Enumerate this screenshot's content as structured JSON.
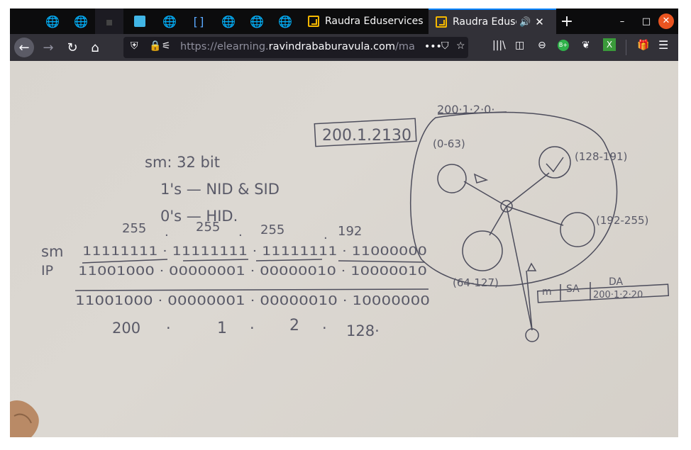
{
  "tabs": {
    "pinned": [
      {
        "icon": "globe-icon"
      },
      {
        "icon": "globe-icon"
      },
      {
        "icon": "blank-tab-icon"
      },
      {
        "icon": "app-icon"
      },
      {
        "icon": "globe-icon"
      },
      {
        "icon": "bracket-icon"
      },
      {
        "icon": "globe-icon"
      },
      {
        "icon": "globe-icon"
      },
      {
        "icon": "globe-icon"
      }
    ],
    "tab1_title": "Raudra Eduservices",
    "tab2_title": "Raudra Eduserv",
    "new_tab_label": "+"
  },
  "window_controls": {
    "minimize": "–",
    "maximize": "□",
    "close": "✕"
  },
  "url": {
    "prefix": "https://elearning.",
    "domain": "ravindrababuravula.com",
    "suffix": "/ma",
    "more": "•••"
  },
  "accent": "#0a84ff",
  "whiteboard": {
    "box_ip": "200.1.2130",
    "sm_line": "sm: 32 bit",
    "ones_line": "1's — NID & SID",
    "zeros_line": "0's — HID.",
    "sm_octets": [
      "255",
      "·",
      "255",
      "·",
      "255",
      "·",
      "192"
    ],
    "sm_label": "sm",
    "ip_label": "IP",
    "sm_bits": "11111111 · 11111111 · 11111111 · 11000000",
    "ip_bits": "11001000 · 00000001 · 00000010 · 10000010",
    "and_bits": "11001000 · 00000001 · 00000010 · 10000000",
    "result": [
      "200",
      "·",
      "1",
      "·",
      "2",
      "·",
      "128·"
    ],
    "network_label": "200·1·2·0·",
    "ranges": [
      "(0-63)",
      "(128-191)",
      "(192-255)",
      "(64-127)"
    ],
    "packet_headers": [
      "m",
      "SA",
      "DA"
    ],
    "packet_da": "200·1·2·20"
  }
}
